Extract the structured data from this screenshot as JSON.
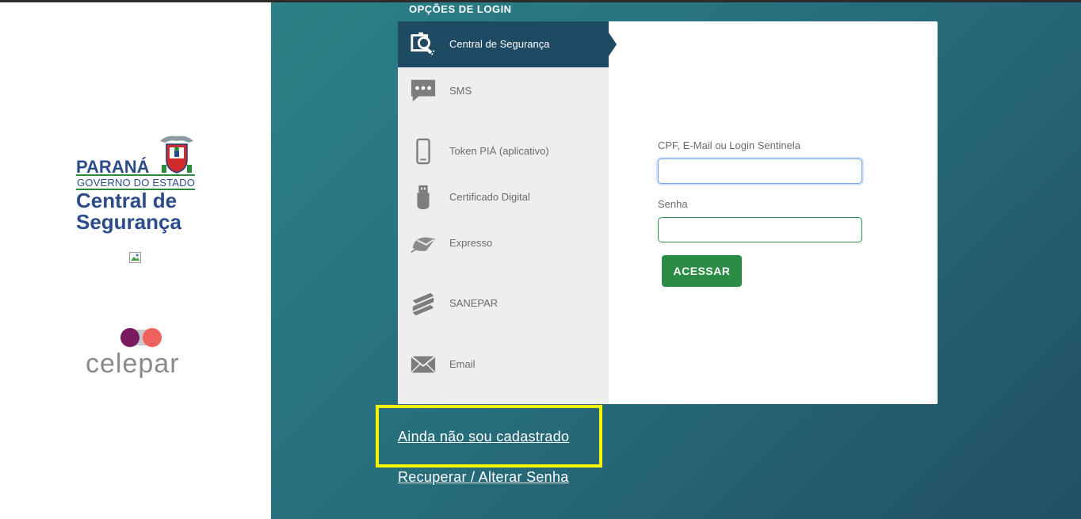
{
  "colors": {
    "panel_gradient_start": "#2a8186",
    "panel_gradient_end": "#224f66",
    "active_option": "#1f4a63",
    "button_green": "#2a8c45",
    "highlight": "#f6f600"
  },
  "branding": {
    "parana_word": "PARANÁ",
    "parana_sub": "GOVERNO DO ESTADO",
    "central_line1": "Central de",
    "central_line2": "Segurança",
    "celepar_word": "celepar"
  },
  "login": {
    "options_title": "OPÇÕES DE LOGIN",
    "options": [
      {
        "label": "Central de Segurança",
        "icon": "key-search-icon",
        "active": true
      },
      {
        "label": "SMS",
        "icon": "chat-dots-icon",
        "active": false
      },
      {
        "label": "Token PIÁ (aplicativo)",
        "icon": "smartphone-icon",
        "active": false
      },
      {
        "label": "Certificado Digital",
        "icon": "usb-token-icon",
        "active": false
      },
      {
        "label": "Expresso",
        "icon": "expresso-mail-icon",
        "active": false
      },
      {
        "label": "SANEPAR",
        "icon": "sanepar-logo-icon",
        "active": false
      },
      {
        "label": "Email",
        "icon": "envelope-icon",
        "active": false
      }
    ],
    "cpf_label": "CPF, E-Mail ou Login Sentinela",
    "cpf_value": "",
    "senha_label": "Senha",
    "senha_value": "",
    "submit_label": "ACESSAR"
  },
  "links": {
    "register": "Ainda não sou cadastrado",
    "recover": "Recuperar / Alterar Senha"
  }
}
